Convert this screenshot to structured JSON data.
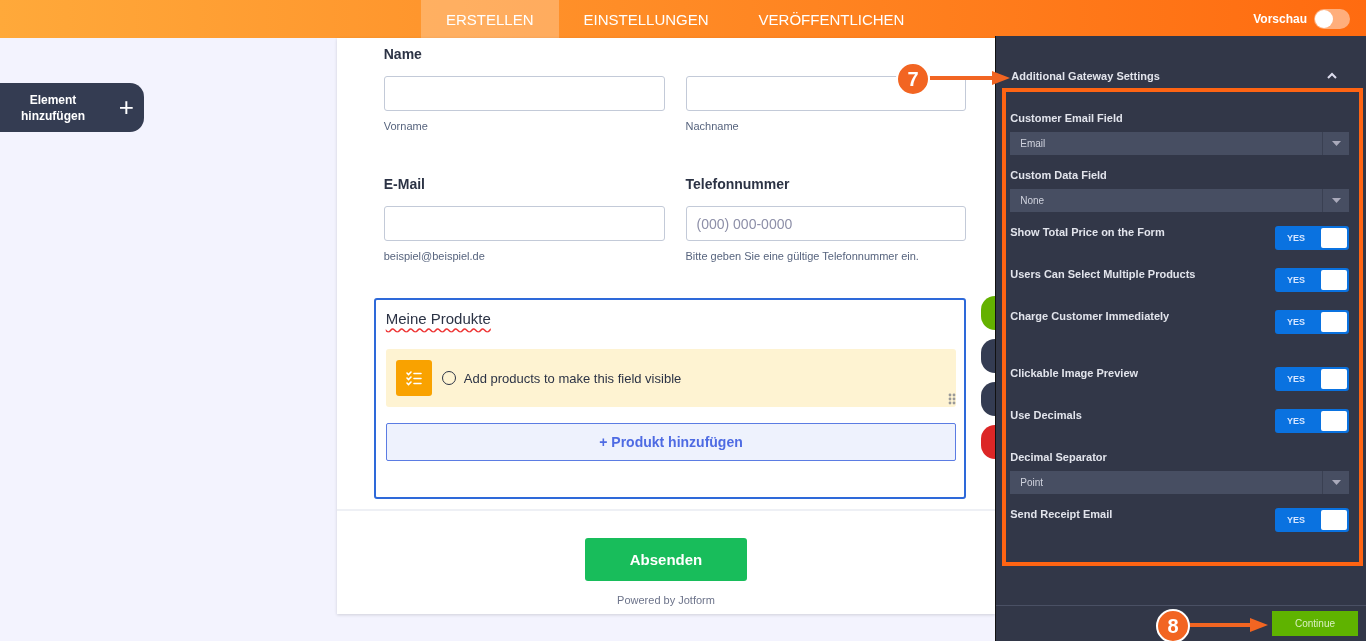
{
  "topbar": {
    "tabs": [
      {
        "label": "ERSTELLEN",
        "selected": true
      },
      {
        "label": "EINSTELLUNGEN",
        "selected": false
      },
      {
        "label": "VERÖFFENTLICHEN",
        "selected": false
      }
    ],
    "preview": {
      "label": "Vorschau",
      "on": false
    }
  },
  "sidebar": {
    "add_element": "Element hinzufügen",
    "add_icon": "+"
  },
  "form": {
    "rows": [
      {
        "fields": [
          {
            "label": "Name",
            "sublabel": "Vorname"
          },
          {
            "sublabel": "Nachname"
          }
        ]
      },
      {
        "fields": [
          {
            "label": "E-Mail",
            "sublabel": "beispiel@beispiel.de"
          },
          {
            "label": "Telefonnummer",
            "placeholder": "(000) 000-0000",
            "sublabel": "Bitte geben Sie eine gültige Telefonnummer ein."
          }
        ]
      }
    ],
    "products": {
      "title": "Meine Produkte",
      "notice": "Add products to make this field visible",
      "notice_checked": false,
      "add_button": "+ Produkt hinzufügen"
    },
    "submit": "Absenden",
    "powered_by": "Powered by Jotform"
  },
  "panel": {
    "title": "Additional Gateway Settings",
    "settings": [
      {
        "kind": "select",
        "label": "Customer Email Field",
        "value": "Email"
      },
      {
        "kind": "select",
        "label": "Custom Data Field",
        "value": "None"
      },
      {
        "kind": "toggle",
        "label": "Show Total Price on the Form",
        "toggle_text": "YES",
        "on": true
      },
      {
        "kind": "toggle",
        "label": "Users Can Select Multiple Products",
        "toggle_text": "YES",
        "on": true
      },
      {
        "kind": "toggle",
        "label": "Charge Customer Immediately",
        "toggle_text": "YES",
        "on": true
      },
      {
        "kind": "toggle",
        "label": "Clickable Image Preview",
        "toggle_text": "YES",
        "on": true
      },
      {
        "kind": "toggle",
        "label": "Use Decimals",
        "toggle_text": "YES",
        "on": true
      },
      {
        "kind": "select",
        "label": "Decimal Separator",
        "value": "Point"
      },
      {
        "kind": "toggle",
        "label": "Send Receipt Email",
        "toggle_text": "YES",
        "on": true
      }
    ],
    "continue": "Continue"
  },
  "annotations": [
    {
      "number": "7"
    },
    {
      "number": "8"
    }
  ]
}
